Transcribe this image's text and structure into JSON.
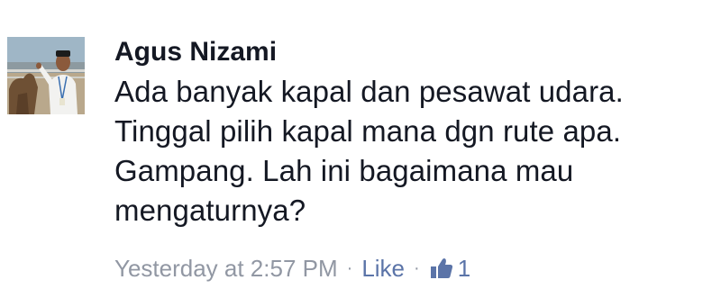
{
  "comment": {
    "author": "Agus Nizami",
    "text_lines": [
      "Ada banyak kapal dan pesawat udara.",
      "Tinggal pilih kapal mana dgn rute apa.",
      "Gampang. Lah ini bagaimana mau",
      "mengaturnya?"
    ],
    "timestamp": "Yesterday at 2:57 PM",
    "separator": "·",
    "like_label": "Like",
    "like_count": "1",
    "icons": {
      "like": "thumbs-up-icon"
    },
    "colors": {
      "author": "#141823",
      "meta": "#9197a3",
      "link": "#5b74a8"
    }
  }
}
